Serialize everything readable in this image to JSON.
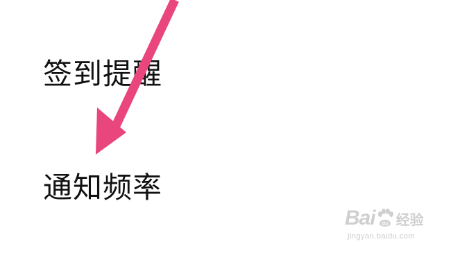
{
  "settings": {
    "items": [
      {
        "label": "签到提醒"
      },
      {
        "label": "通知频率"
      }
    ]
  },
  "annotation": {
    "arrow_color": "#e8467c",
    "arrow_icon": "pointer-arrow-icon"
  },
  "watermark": {
    "brand_prefix": "Bai",
    "brand_suffix": "经验",
    "url": "jingyan.baidu.com",
    "paw_icon": "baidu-paw-icon"
  }
}
